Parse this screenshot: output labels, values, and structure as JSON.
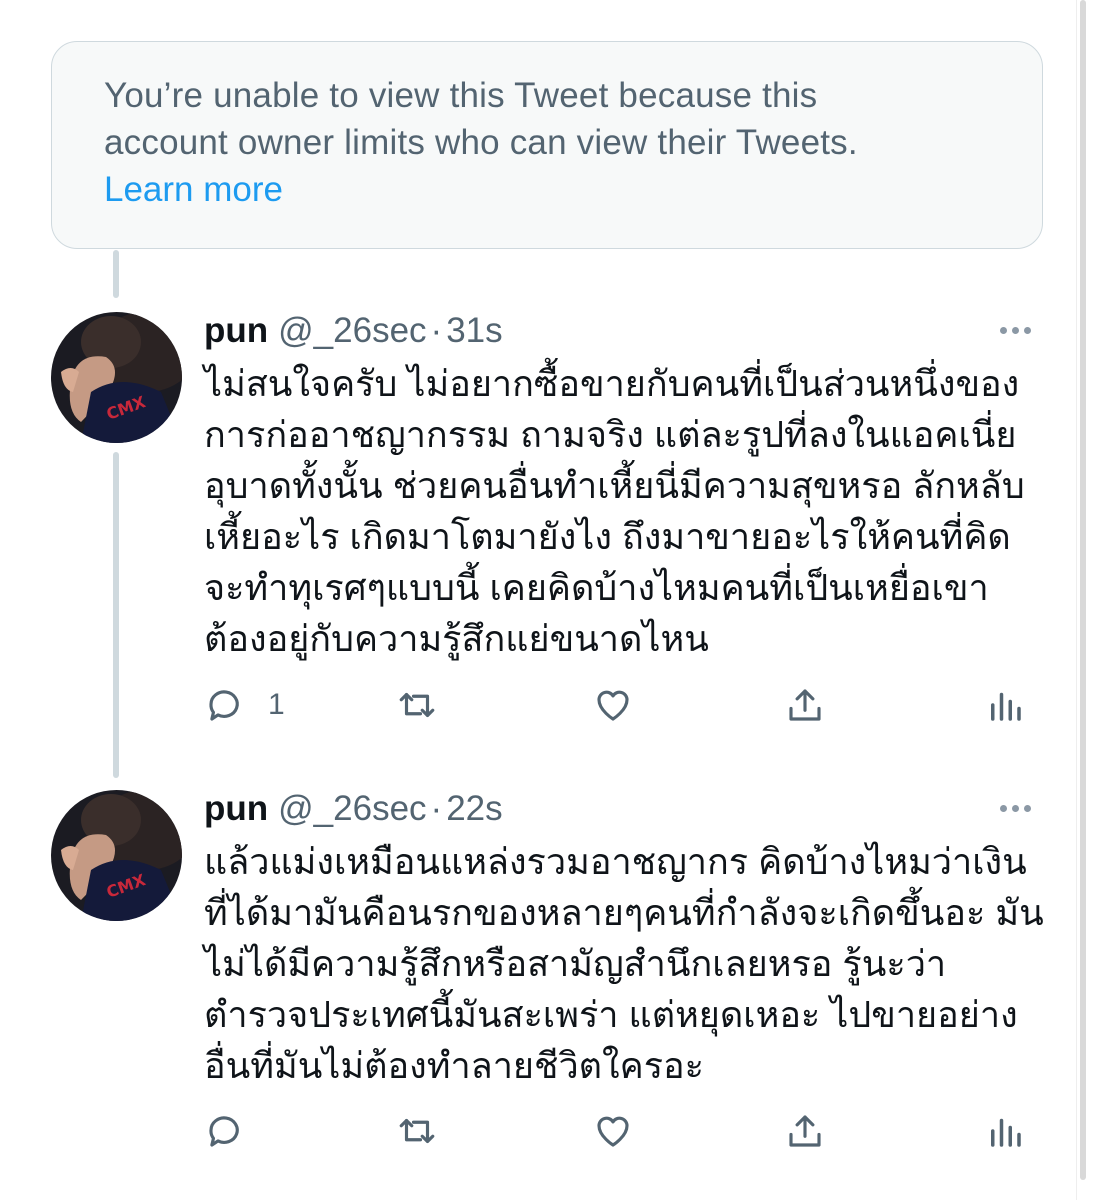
{
  "notice": {
    "line1": "You’re unable to view this Tweet because this",
    "line2": "account owner limits who can view their Tweets.",
    "link": "Learn more"
  },
  "tweets": [
    {
      "name": "pun",
      "handle": "@_26sec",
      "dot": "·",
      "time": "31s",
      "lines": [
        "ไม่สนใจครับ ไม่อยากซื้อขายกับคนที่เป็นส่วนหนึ่งของ",
        "การก่ออาชญากรรม ถามจริง แต่ละรูปที่ลงในแอคเนี่ย",
        "อุบาดทั้งนั้น ช่วยคนอื่นทำเหี้ยนี่มีความสุขหรอ ลักหลับ",
        "เหี้ยอะไร เกิดมาโตมายังไง ถึงมาขายอะไรให้คนที่คิด",
        "จะทำทุเรศๆแบบนี้ เคยคิดบ้างไหมคนที่เป็นเหยื่อเขา",
        "ต้องอยู่กับความรู้สึกแย่ขนาดไหน"
      ],
      "reply_count": "1"
    },
    {
      "name": "pun",
      "handle": "@_26sec",
      "dot": "·",
      "time": "22s",
      "lines": [
        "แล้วแม่งเหมือนแหล่งรวมอาชญากร คิดบ้างไหมว่าเงิน",
        "ที่ได้มามันคือนรกของหลายๆคนที่กำลังจะเกิดขึ้นอะ มัน",
        "ไม่ได้มีความรู้สึกหรือสามัญสำนึกเลยหรอ รู้นะว่า",
        "ตำรวจประเทศนี้มันสะเพร่า แต่หยุดเหอะ ไปขายอย่าง",
        "อื่นที่มันไม่ต้องทำลายชีวิตใครอะ"
      ],
      "reply_count": ""
    }
  ],
  "icons": [
    "more-icon",
    "reply-icon",
    "retweet-icon",
    "like-icon",
    "share-icon",
    "analytics-icon"
  ],
  "colors": {
    "text": "#0f1419",
    "secondary": "#536471",
    "link": "#1d9bf0",
    "notice_bg": "#f7f9f9",
    "border": "#cfd9de"
  }
}
